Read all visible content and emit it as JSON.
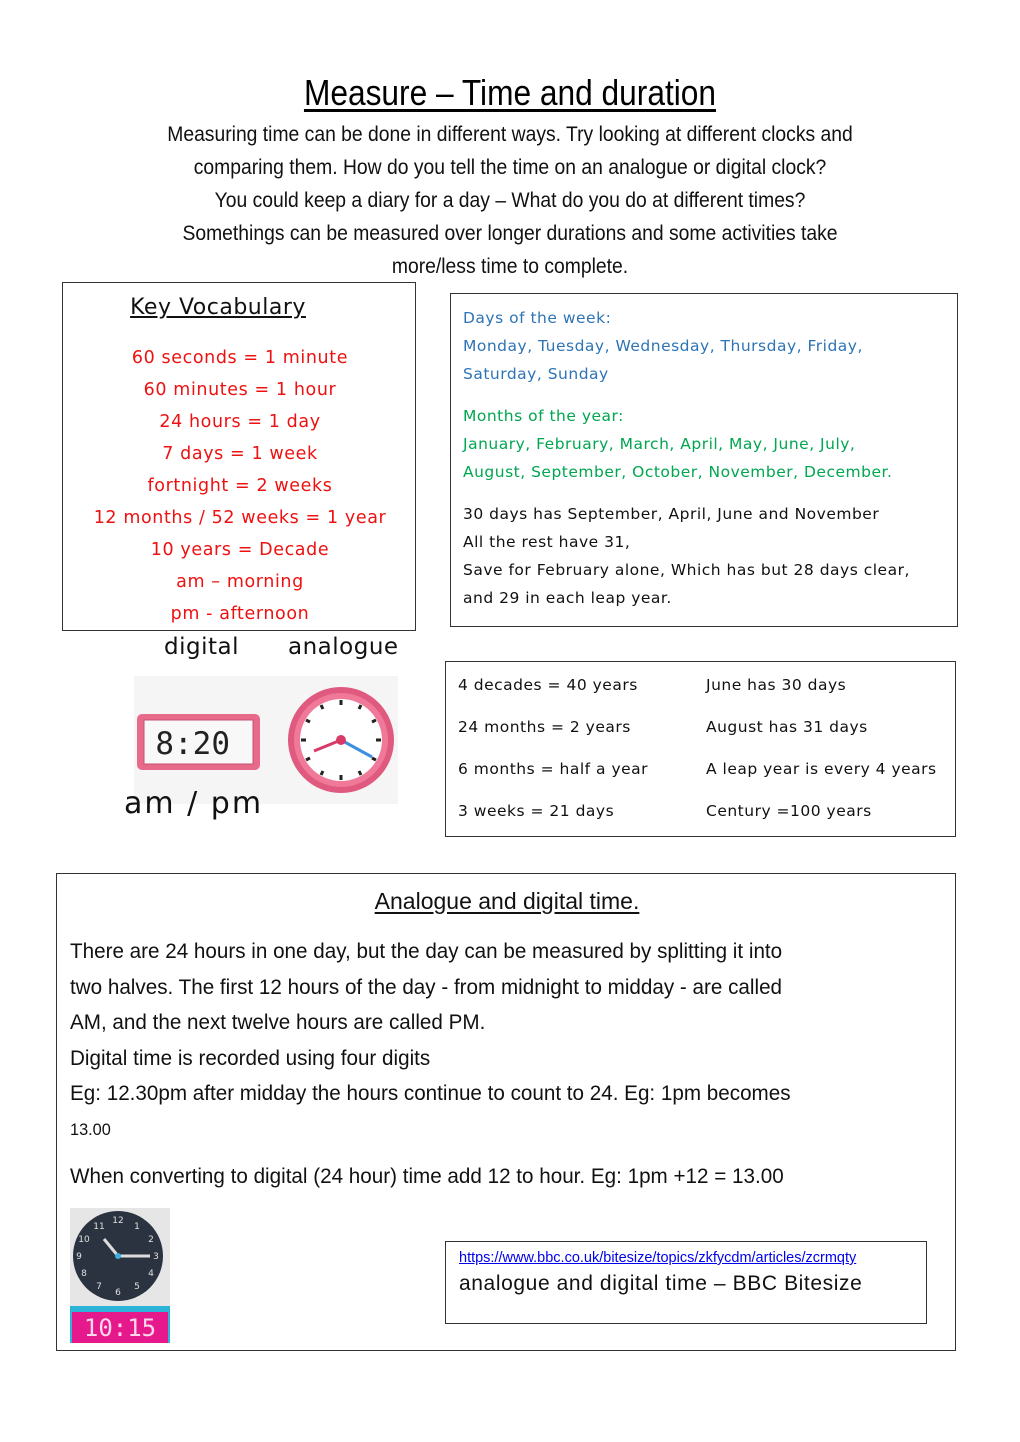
{
  "header": {
    "title": "Measure – Time and duration",
    "intro_lines": [
      "Measuring time can be done in different ways. Try looking at different clocks and",
      "comparing them. How do you tell the time on an analogue or digital clock?",
      "You could keep a diary for a day – What do you do at different times?",
      "Somethings can be measured over longer durations and some activities take",
      "more/less time to complete."
    ]
  },
  "vocabulary": {
    "title": "Key Vocabulary",
    "items": [
      "60 seconds = 1 minute",
      "60 minutes = 1 hour",
      "24 hours = 1 day",
      "7 days = 1 week",
      "fortnight = 2 weeks",
      "12 months / 52 weeks = 1 year",
      "10 years = Decade",
      "am – morning",
      "pm - afternoon"
    ],
    "color": "#ee1111"
  },
  "calendar": {
    "days_heading": "Days of the week:",
    "days_lines": [
      "Monday, Tuesday, Wednesday, Thursday, Friday,",
      "Saturday, Sunday"
    ],
    "months_heading": "Months of the year:",
    "months_lines": [
      "January, February, March, April, May, June, July,",
      "August, September, October, November, December."
    ],
    "rhyme_lines": [
      "30 days has September, April, June and November",
      "All the rest have 31,",
      "Save for February alone, Which has but 28 days clear,",
      "and 29 in each leap year."
    ],
    "days_color": "#2e74b5",
    "months_color": "#00a650"
  },
  "clock_labels": {
    "digital": "digital",
    "analogue": "analogue",
    "digital_time": "8:20",
    "ampm": "am / pm"
  },
  "facts": {
    "rows": [
      {
        "left": "4 decades = 40 years",
        "right": "June has 30 days"
      },
      {
        "left": "24 months = 2 years",
        "right": "August has 31 days"
      },
      {
        "left": "6 months = half a year",
        "right": "A leap year is every 4 years"
      },
      {
        "left": "3 weeks = 21 days",
        "right": "Century =100 years"
      }
    ]
  },
  "analogue_digital": {
    "title": " Analogue and digital time.",
    "lines": [
      "There are 24 hours in one day, but the day can be measured by splitting it into",
      "two halves. The first 12 hours of the day - from midnight to midday - are called",
      "AM, and the next twelve hours are called PM.",
      "Digital time is recorded using four digits",
      "Eg: 12.30pm after midday the hours continue to count to 24.  Eg: 1pm becomes",
      "13.00",
      "When converting to digital (24 hour) time add 12 to hour. Eg: 1pm +12 = 13.00"
    ],
    "example_digital_time": "10:15"
  },
  "bitesize": {
    "url": "https://www.bbc.co.uk/bitesize/topics/zkfycdm/articles/zcrmqty",
    "description": "analogue and digital time – BBC Bitesize"
  }
}
